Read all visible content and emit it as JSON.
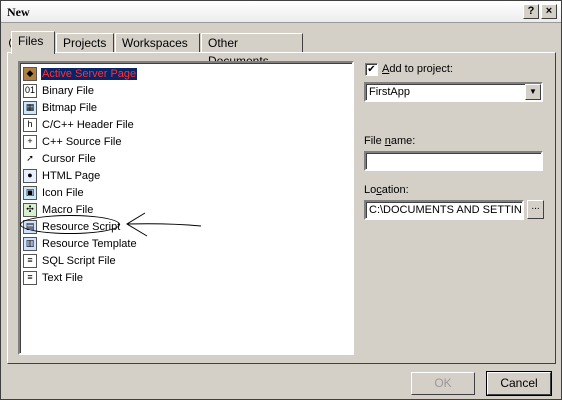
{
  "window": {
    "title": "New",
    "help_btn": "?",
    "close_btn": "×"
  },
  "tabs": [
    {
      "label": "Files",
      "active": true
    },
    {
      "label": "Projects",
      "active": false
    },
    {
      "label": "Workspaces",
      "active": false
    },
    {
      "label": "Other Documents",
      "active": false
    }
  ],
  "file_types": [
    {
      "label": "Active Server Page",
      "icon": "asp-icon",
      "selected": true
    },
    {
      "label": "Binary File",
      "icon": "binary-file-icon",
      "selected": false
    },
    {
      "label": "Bitmap File",
      "icon": "bitmap-file-icon",
      "selected": false
    },
    {
      "label": "C/C++ Header File",
      "icon": "header-file-icon",
      "selected": false
    },
    {
      "label": "C++ Source File",
      "icon": "source-file-icon",
      "selected": false
    },
    {
      "label": "Cursor File",
      "icon": "cursor-file-icon",
      "selected": false
    },
    {
      "label": "HTML Page",
      "icon": "html-page-icon",
      "selected": false
    },
    {
      "label": "Icon File",
      "icon": "icon-file-icon",
      "selected": false
    },
    {
      "label": "Macro File",
      "icon": "macro-file-icon",
      "selected": false
    },
    {
      "label": "Resource Script",
      "icon": "resource-script-icon",
      "selected": false
    },
    {
      "label": "Resource Template",
      "icon": "resource-template-icon",
      "selected": false
    },
    {
      "label": "SQL Script File",
      "icon": "sql-script-icon",
      "selected": false
    },
    {
      "label": "Text File",
      "icon": "text-file-icon",
      "selected": false
    }
  ],
  "add_to_project": {
    "checked": true,
    "check_glyph": "✔",
    "label_prefix": "",
    "label_accel": "A",
    "label_rest": "dd to project:",
    "project_value": "FirstApp",
    "dropdown_glyph": "▼"
  },
  "file_name": {
    "label_prefix": "File ",
    "label_accel": "n",
    "label_rest": "ame:",
    "value": ""
  },
  "location": {
    "label_prefix": "Lo",
    "label_accel": "c",
    "label_rest": "ation:",
    "value": "C:\\DOCUMENTS AND SETTIN",
    "browse_label": "..."
  },
  "buttons": {
    "ok": "OK",
    "cancel": "Cancel"
  },
  "colors": {
    "dialog_bg": "#d4d0c8",
    "selection_bg": "#0a246a",
    "selection_text": "#ff3030"
  }
}
